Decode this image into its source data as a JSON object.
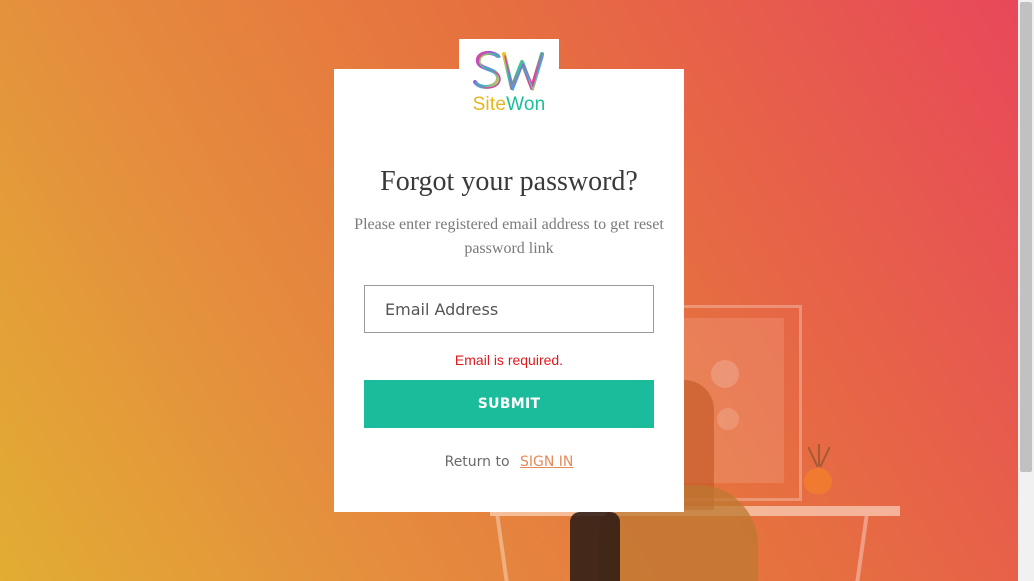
{
  "brand": {
    "name_part1": "Site",
    "name_part2": "Won",
    "monogram": "SW"
  },
  "colors": {
    "accent": "#1bbc9b",
    "error": "#e0191d",
    "link": "#e58a5a",
    "brand_yellow": "#e6b61e",
    "brand_green": "#1bbf9a"
  },
  "form": {
    "title": "Forgot your password?",
    "subtitle": "Please enter registered email address to get reset password link",
    "email_placeholder": "Email Address",
    "email_value": "",
    "error_text": "Email is required.",
    "submit_label": "SUBMIT",
    "return_text": "Return to",
    "signin_label": "SIGN IN"
  }
}
